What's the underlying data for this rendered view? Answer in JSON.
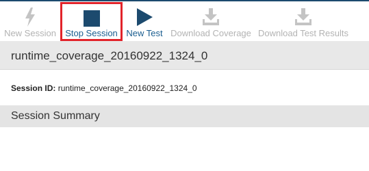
{
  "toolbar": {
    "new_session": {
      "label": "New Session",
      "icon": "lightning-icon",
      "enabled": false
    },
    "stop_session": {
      "label": "Stop Session",
      "icon": "stop-icon",
      "enabled": true,
      "highlighted": true
    },
    "new_test": {
      "label": "New Test",
      "icon": "play-icon",
      "enabled": true
    },
    "download_coverage": {
      "label": "Download Coverage",
      "icon": "download-icon",
      "enabled": false
    },
    "download_test_results": {
      "label": "Download Test Results",
      "icon": "download-icon",
      "enabled": false
    }
  },
  "session": {
    "title": "runtime_coverage_20160922_1324_0",
    "id_label": "Session ID:",
    "id_value": "runtime_coverage_20160922_1324_0"
  },
  "summary": {
    "title": "Session Summary"
  },
  "colors": {
    "accent": "#1a5d8f",
    "icon_blue": "#1c4a6e",
    "disabled": "#b3b3b3",
    "highlight_border": "#e2232a",
    "section_bg": "#e8e8e8"
  }
}
